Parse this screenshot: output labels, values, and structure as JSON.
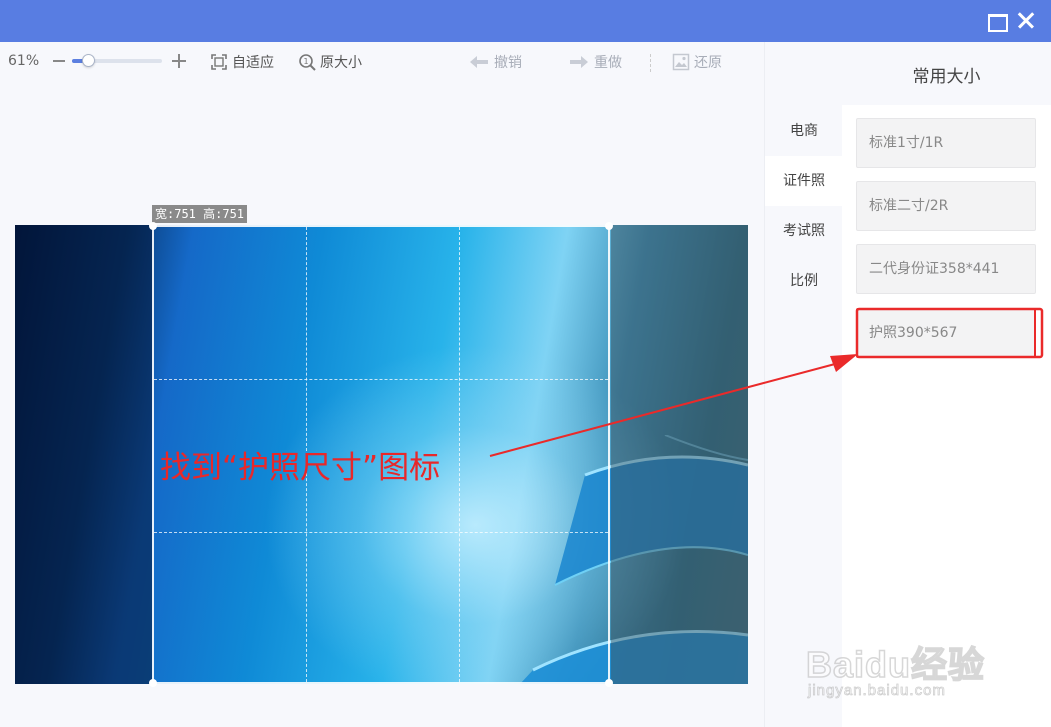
{
  "window": {
    "maximize_icon": "maximize-icon",
    "close_icon": "close-icon",
    "titlebar_color": "#587de2"
  },
  "toolbar": {
    "zoom_percent": "61%",
    "zoom_level": 0.61,
    "fit_label": "自适应",
    "original_label": "原大小",
    "undo_label": "撤销",
    "redo_label": "重做",
    "restore_label": "还原"
  },
  "canvas": {
    "size_label": "宽:751 高:751",
    "annotation": "找到“护照尺寸”图标",
    "annotation_color": "#e8282a"
  },
  "side_tabs": [
    {
      "label": "电商"
    },
    {
      "label": "证件照"
    },
    {
      "label": "考试照"
    },
    {
      "label": "比例"
    }
  ],
  "panel": {
    "title": "常用大小",
    "options": [
      {
        "label": "标准1寸/1R"
      },
      {
        "label": "标准二寸/2R"
      },
      {
        "label": "二代身份证358*441"
      },
      {
        "label": "护照390*567"
      }
    ],
    "highlight_color": "#ea2a2a"
  },
  "watermark": {
    "line1": "Baidu经验",
    "line2": "jingyan.baidu.com"
  }
}
